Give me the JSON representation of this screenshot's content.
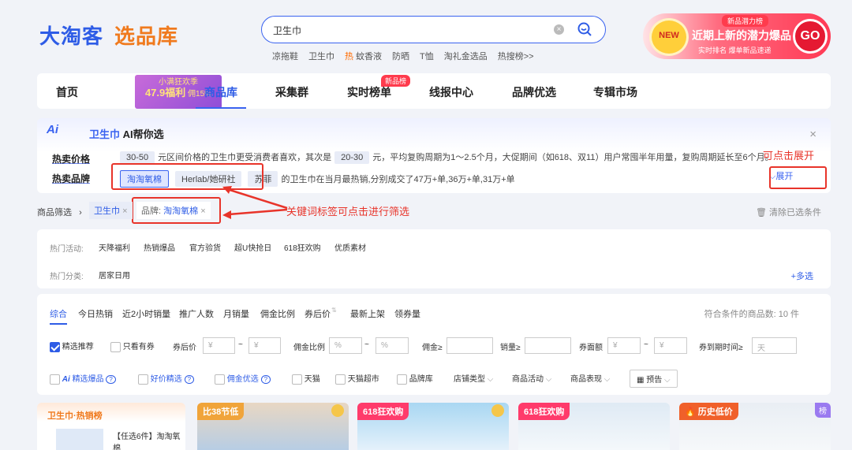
{
  "logo": {
    "part1": "大淘客",
    "part2": "选品库"
  },
  "search": {
    "value": "卫生巾",
    "clear_label": "×"
  },
  "hot_words": [
    "凉拖鞋",
    "卫生巾",
    "蚊香液",
    "防晒",
    "T恤",
    "淘礼金选品",
    "热搜榜>>"
  ],
  "hot_fire_label": "热",
  "banner": {
    "badge": "NEW",
    "tag": "新品潜力榜",
    "title": "近期上新的潜力爆品",
    "subtitle": "实时排名 爆单新品速递",
    "go": "GO"
  },
  "nav": {
    "items": [
      "首页",
      "商品库",
      "采集群",
      "实时榜单",
      "线报中心",
      "品牌优选",
      "专辑市场"
    ],
    "promo_line1": "小满狂欢季",
    "promo_line2": "47.9福利",
    "promo_line3": "佣15%",
    "badge": "新品榜"
  },
  "ai": {
    "icon": "Ai",
    "keyword": "卫生巾",
    "title": "AI帮你选",
    "price_label": "热卖价格",
    "price_chip1": "30-50",
    "price_text1": "元区间价格的卫生巾更受消费者喜欢，其次是",
    "price_chip2": "20-30",
    "price_text2": "元，平均复购周期为1～2.5个月，大促期间（如618、双11）用户常囤半年用量，复购周期延长至6个月。",
    "brand_label": "热卖品牌",
    "brands": [
      "淘淘氧棉",
      "Herlab/她研社",
      "苏菲"
    ],
    "brand_text": "的卫生巾在当月最热销,分别成交了47万+单,36万+单,31万+单",
    "expand": "展开",
    "close": "×"
  },
  "annotations": {
    "expand_note": "可点击展开",
    "filter_note": "关键词标签可点击进行筛选"
  },
  "crumb": {
    "label": "商品筛选",
    "chip1": "卫生巾",
    "chip2_key": "品牌:",
    "chip2_value": "淘淘氧棉",
    "chip_close": "×",
    "clear": "清除已选条件"
  },
  "filters": {
    "activity_label": "热门活动:",
    "activities": [
      "天降福利",
      "热销爆品",
      "官方验货",
      "超U快抢日",
      "618狂欢购",
      "优质素材"
    ],
    "category_label": "热门分类:",
    "categories": [
      "居家日用"
    ],
    "more": "+多选"
  },
  "sort": {
    "tabs": [
      "综合",
      "今日热销",
      "近2小时销量",
      "推广人数",
      "月销量",
      "佣金比例",
      "券后价",
      "最新上架",
      "领券量"
    ],
    "count_text": "符合条件的商品数:  10 件",
    "row2": {
      "recommend": "精选推荐",
      "coupon_only": "只看有券",
      "after_price": "券后价",
      "yen": "¥",
      "commission": "佣金比例",
      "pct": "%",
      "commission_amt": "佣金≥",
      "sales": "销量≥",
      "coupon_amt": "券面额",
      "expiry": "券到期时间≥",
      "day": "天",
      "tilde": "~"
    },
    "row3": {
      "ai_pick": "精选爆品",
      "good_price": "好价精选",
      "commission_pick": "佣金优选",
      "tmall": "天猫",
      "tmall_mart": "天猫超市",
      "brand_lib": "品牌库",
      "shop_type": "店铺类型",
      "activity": "商品活动",
      "performance": "商品表现",
      "preview": "预告",
      "help": "?"
    }
  },
  "cards": [
    {
      "tag": "卫生巾·热销榜",
      "text": "【任选6件】淘淘氧棉"
    },
    {
      "tag": "比38节低"
    },
    {
      "tag": "618狂欢购"
    },
    {
      "tag": "618狂欢购"
    },
    {
      "tag": "历史低价",
      "corner": "榜"
    }
  ],
  "colors": {
    "primary": "#2e5ce6",
    "orange": "#f07a1e",
    "annotation_red": "#e8342a"
  }
}
